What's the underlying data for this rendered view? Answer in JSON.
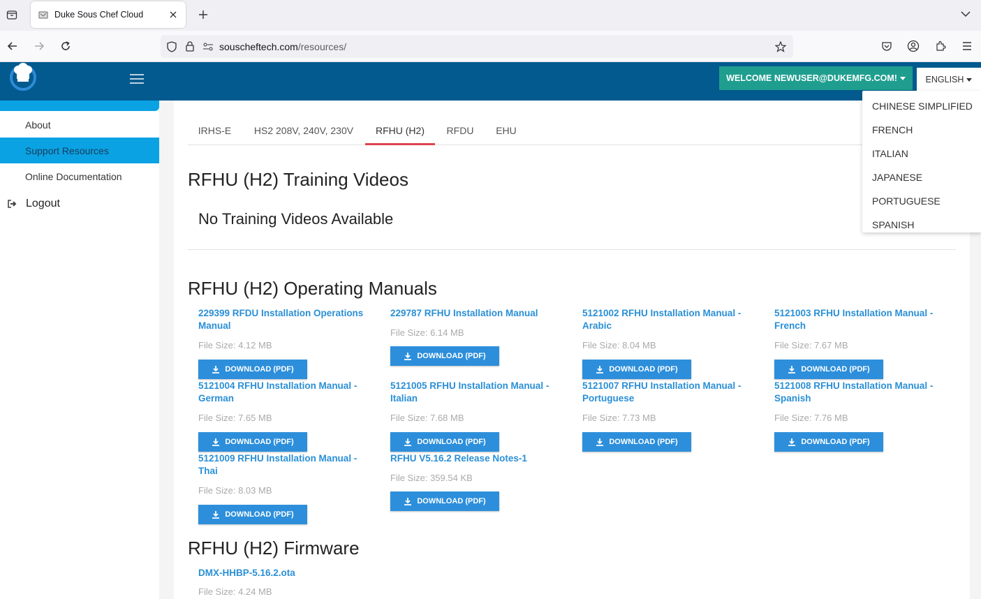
{
  "browser": {
    "tab_title": "Duke Sous Chef Cloud",
    "url_domain": "souscheftech.com",
    "url_path": "/resources/"
  },
  "header": {
    "welcome": "WELCOME NEWUSER@DUKEMFG.COM!",
    "language": "ENGLISH"
  },
  "language_menu": [
    "CHINESE SIMPLIFIED",
    "FRENCH",
    "ITALIAN",
    "JAPANESE",
    "PORTUGUESE",
    "SPANISH"
  ],
  "sidebar": {
    "items": [
      {
        "label": "About"
      },
      {
        "label": "Support Resources",
        "active": true
      },
      {
        "label": "Online Documentation"
      }
    ],
    "logout": "Logout"
  },
  "product_tabs": [
    {
      "label": "IRHS-E"
    },
    {
      "label": "HS2 208V, 240V, 230V"
    },
    {
      "label": "RFHU (H2)",
      "active": true
    },
    {
      "label": "RFDU"
    },
    {
      "label": "EHU"
    }
  ],
  "sections": {
    "videos_title": "RFHU (H2) Training Videos",
    "no_videos": "No Training Videos Available",
    "manuals_title": "RFHU (H2) Operating Manuals",
    "firmware_title": "RFHU (H2) Firmware"
  },
  "download_label": "DOWNLOAD (PDF)",
  "manuals": [
    {
      "title": "229399 RFDU Installation Operations Manual",
      "size": "File Size: 4.12 MB"
    },
    {
      "title": "229787 RFHU Installation Manual",
      "size": "File Size: 6.14 MB"
    },
    {
      "title": "5121002 RFHU Installation Manual - Arabic",
      "size": "File Size: 8.04 MB"
    },
    {
      "title": "5121003 RFHU Installation Manual - French",
      "size": "File Size: 7.67 MB"
    },
    {
      "title": "5121004 RFHU Installation Manual - German",
      "size": "File Size: 7.65 MB"
    },
    {
      "title": "5121005 RFHU Installation Manual - Italian",
      "size": "File Size: 7.68 MB"
    },
    {
      "title": "5121007 RFHU Installation Manual - Portuguese",
      "size": "File Size: 7.73 MB"
    },
    {
      "title": "5121008 RFHU Installation Manual - Spanish",
      "size": "File Size: 7.76 MB"
    },
    {
      "title": "5121009 RFHU Installation Manual - Thai",
      "size": "File Size: 8.03 MB"
    },
    {
      "title": "RFHU V5.16.2 Release Notes-1",
      "size": "File Size: 359.54 KB"
    }
  ],
  "firmware": [
    {
      "title": "DMX-HHBP-5.16.2.ota",
      "size": "File Size: 4.24 MB"
    }
  ]
}
